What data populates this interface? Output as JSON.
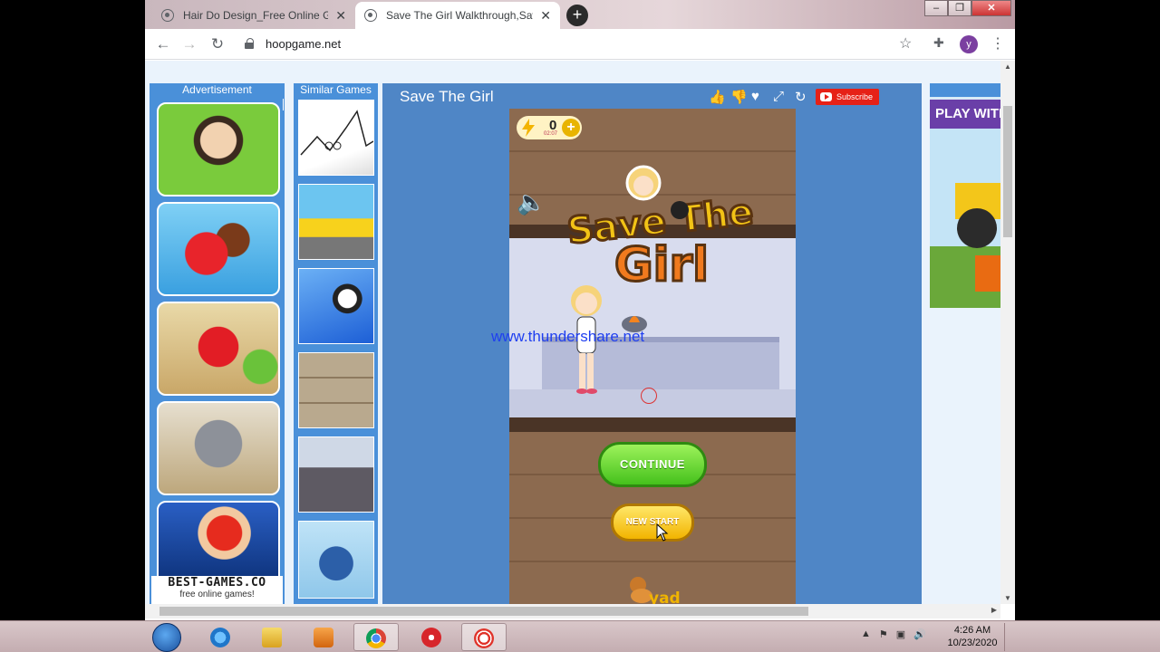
{
  "browser": {
    "tabs": [
      {
        "title": "Hair Do Design_Free Online Gam",
        "active": false
      },
      {
        "title": "Save The Girl Walkthrough,Save",
        "active": true
      }
    ],
    "url": "hoopgame.net",
    "profile_initial": "y",
    "window_controls": [
      "–",
      "❐",
      "✕"
    ]
  },
  "page": {
    "advertisement_label": "Advertisement",
    "ad_tiles": [
      "ben-10",
      "candy",
      "angry-birds",
      "talking-tom",
      "mario"
    ],
    "ad_brand": "BEST-GAMES.CO",
    "ad_brand_sub": "free online games!",
    "similar_label": "Similar Games",
    "similar_tiles": [
      "line-biker",
      "traffic-go",
      "shooter",
      "stickman-room",
      "street-runner",
      "penguin"
    ],
    "game_title": "Save The Girl",
    "subscribe_label": "Subscribe",
    "right_ad_text": "PLAY WITH"
  },
  "game": {
    "coin_count": "0",
    "coin_timer": "02:07",
    "logo_line1": "Save The",
    "logo_line2": "Girl",
    "continue_label": "CONTINUE",
    "new_start_label": "NEW START",
    "footer_text": "yad"
  },
  "watermark": "www.thundershare.net",
  "taskbar": {
    "time": "4:26 AM",
    "date": "10/23/2020",
    "pinned": [
      "internet-explorer",
      "file-explorer",
      "media-player",
      "chrome",
      "app-red",
      "screen-recorder"
    ],
    "colors": {
      "accent_blue": "#4a90d9",
      "continue_green": "#45c11c",
      "new_start_yellow": "#f2b400"
    }
  }
}
